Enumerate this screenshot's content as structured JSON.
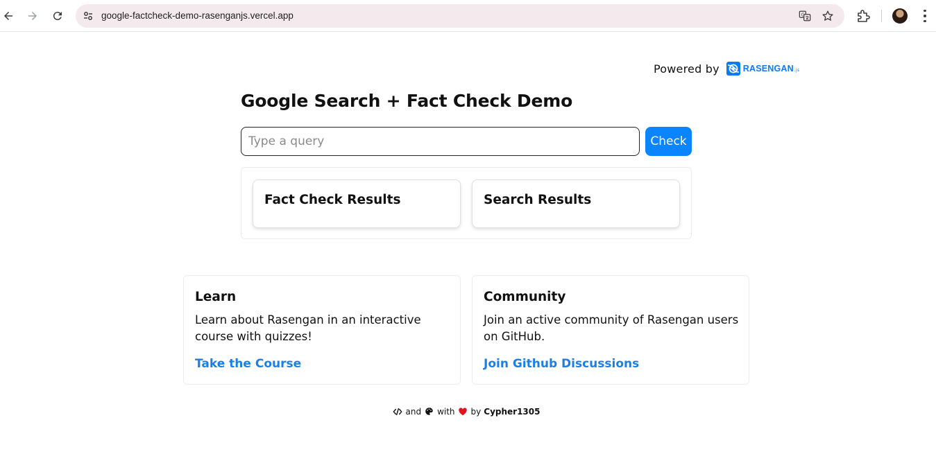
{
  "browser": {
    "url": "google-factcheck-demo-rasenganjs.vercel.app"
  },
  "header": {
    "powered_by": "Powered by",
    "logo_text": "RASENGAN",
    "logo_suffix": ".js"
  },
  "main": {
    "title": "Google Search + Fact Check Demo",
    "search": {
      "placeholder": "Type a query",
      "value": "",
      "button_label": "Check"
    },
    "results": {
      "fact_check_title": "Fact Check Results",
      "search_title": "Search Results"
    }
  },
  "cards": [
    {
      "title": "Learn",
      "body": "Learn about Rasengan in an interactive course with quizzes!",
      "link": "Take the Course"
    },
    {
      "title": "Community",
      "body": "Join an active community of Rasengan users on GitHub.",
      "link": "Join Github Discussions"
    }
  ],
  "footer": {
    "and": "and",
    "with": "with",
    "by": "by",
    "author": "Cypher1305"
  },
  "colors": {
    "accent": "#0a84ff",
    "link": "#1a7fe6",
    "logo": "#0b7bf0",
    "heart": "#e0141e"
  }
}
